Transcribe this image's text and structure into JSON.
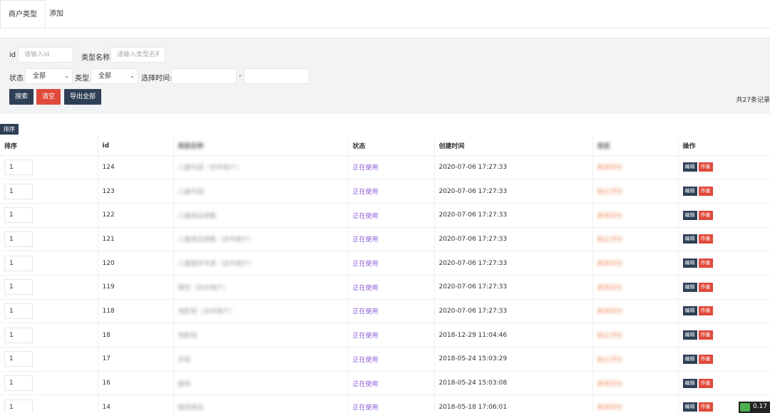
{
  "tabs": [
    {
      "label": "商户类型",
      "active": true
    },
    {
      "label": "添加",
      "active": false
    }
  ],
  "filter": {
    "id_label": "id",
    "id_placeholder": "请输入id",
    "type_name_label": "类型名称",
    "type_name_placeholder": "请输入类型名称",
    "status_label": "状态",
    "status_value": "全部",
    "type_label": "类型",
    "type_value": "全部",
    "time_label": "选择时间:",
    "time_separator": "-",
    "search_btn": "搜索",
    "clear_btn": "清空",
    "export_btn": "导出全部",
    "total_text": "共27条记录"
  },
  "sort_tag": "排序",
  "table": {
    "headers": [
      "排序",
      "id",
      "类型名称",
      "状态",
      "创建时间",
      "类型",
      "操作"
    ],
    "edit_label": "编辑",
    "delete_label": "作废",
    "rows": [
      {
        "sort": "1",
        "id": "124",
        "name": "儿童乐园（合作商户）",
        "status": "正在使用",
        "created": "2020-07-06 17:27:33",
        "kind": "商场评价"
      },
      {
        "sort": "1",
        "id": "123",
        "name": "儿童乐园",
        "status": "正在使用",
        "created": "2020-07-06 17:27:33",
        "kind": "独立评价"
      },
      {
        "sort": "1",
        "id": "122",
        "name": "儿童商品销售",
        "status": "正在使用",
        "created": "2020-07-06 17:27:33",
        "kind": "商场评价"
      },
      {
        "sort": "1",
        "id": "121",
        "name": "儿童商品销售（合作商户）",
        "status": "正在使用",
        "created": "2020-07-06 17:27:33",
        "kind": "独立评价"
      },
      {
        "sort": "1",
        "id": "120",
        "name": "儿童服饰专卖（合作商户）",
        "status": "正在使用",
        "created": "2020-07-06 17:27:33",
        "kind": "商场评价"
      },
      {
        "sort": "1",
        "id": "119",
        "name": "餐饮（合作商户）",
        "status": "正在使用",
        "created": "2020-07-06 17:27:33",
        "kind": "商场评价"
      },
      {
        "sort": "1",
        "id": "118",
        "name": "电影院（合作商户）",
        "status": "正在使用",
        "created": "2020-07-06 17:27:33",
        "kind": "商场评价"
      },
      {
        "sort": "1",
        "id": "18",
        "name": "电影院",
        "status": "正在使用",
        "created": "2018-12-29 11:04:46",
        "kind": "独立评价"
      },
      {
        "sort": "1",
        "id": "17",
        "name": "步街",
        "status": "正在使用",
        "created": "2018-05-24 15:03:29",
        "kind": "独立评价"
      },
      {
        "sort": "1",
        "id": "16",
        "name": "服饰",
        "status": "正在使用",
        "created": "2018-05-24 15:03:08",
        "kind": "商场评价"
      },
      {
        "sort": "1",
        "id": "14",
        "name": "精选商品",
        "status": "正在使用",
        "created": "2018-05-18 17:06:01",
        "kind": "商场评价"
      }
    ]
  },
  "corner_badge": "0.17"
}
